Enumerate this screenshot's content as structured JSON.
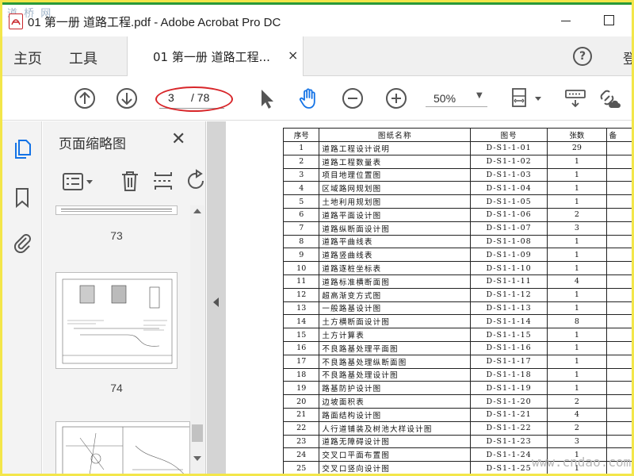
{
  "window": {
    "title": "01 第一册 道路工程.pdf - Adobe Acrobat Pro DC",
    "watermark": "道 桥 网"
  },
  "tabs": {
    "home_label": "主页",
    "tools_label": "工具",
    "document_tab_label": "01 第一册 道路工程...",
    "close_glyph": "×",
    "signin_label": "登"
  },
  "toolbar": {
    "current_page": "3",
    "total_pages": "/ 78",
    "zoom": "50%"
  },
  "thumbnail_pane": {
    "title": "页面缩略图",
    "close_glyph": "✕",
    "pages": [
      {
        "number": "73"
      },
      {
        "number": "74"
      },
      {
        "number": "75"
      }
    ]
  },
  "table": {
    "headers": [
      "序号",
      "图纸名称",
      "图号",
      "张数",
      "备"
    ],
    "rows": [
      [
        "1",
        "道路工程设计说明",
        "D-S1-1-01",
        "29"
      ],
      [
        "2",
        "道路工程数量表",
        "D-S1-1-02",
        "1"
      ],
      [
        "3",
        "项目地理位置图",
        "D-S1-1-03",
        "1"
      ],
      [
        "4",
        "区域路网规划图",
        "D-S1-1-04",
        "1"
      ],
      [
        "5",
        "土地利用规划图",
        "D-S1-1-05",
        "1"
      ],
      [
        "6",
        "道路平面设计图",
        "D-S1-1-06",
        "2"
      ],
      [
        "7",
        "道路纵断面设计图",
        "D-S1-1-07",
        "3"
      ],
      [
        "8",
        "道路平曲线表",
        "D-S1-1-08",
        "1"
      ],
      [
        "9",
        "道路竖曲线表",
        "D-S1-1-09",
        "1"
      ],
      [
        "10",
        "道路逐桩坐标表",
        "D-S1-1-10",
        "1"
      ],
      [
        "11",
        "道路标准横断面图",
        "D-S1-1-11",
        "4"
      ],
      [
        "12",
        "超高渐变方式图",
        "D-S1-1-12",
        "1"
      ],
      [
        "13",
        "一般路基设计图",
        "D-S1-1-13",
        "1"
      ],
      [
        "14",
        "土方横断面设计图",
        "D-S1-1-14",
        "8"
      ],
      [
        "15",
        "土方计算表",
        "D-S1-1-15",
        "1"
      ],
      [
        "16",
        "不良路基处理平面图",
        "D-S1-1-16",
        "1"
      ],
      [
        "17",
        "不良路基处理纵断面图",
        "D-S1-1-17",
        "1"
      ],
      [
        "18",
        "不良路基处理设计图",
        "D-S1-1-18",
        "1"
      ],
      [
        "19",
        "路基防护设计图",
        "D-S1-1-19",
        "1"
      ],
      [
        "20",
        "边坡面积表",
        "D-S1-1-20",
        "2"
      ],
      [
        "21",
        "路面结构设计图",
        "D-S1-1-21",
        "4"
      ],
      [
        "22",
        "人行道铺装及树池大样设计图",
        "D-S1-1-22",
        "2"
      ],
      [
        "23",
        "道路无障碍设计图",
        "D-S1-1-23",
        "3"
      ],
      [
        "24",
        "交叉口平面布置图",
        "D-S1-1-24",
        "1"
      ],
      [
        "25",
        "交叉口竖向设计图",
        "D-S1-1-25",
        "1"
      ]
    ]
  },
  "site_watermark": "www.cndao.com",
  "colors": {
    "frame_outer": "#f3e64a",
    "top_stripe": "#2a9a3a",
    "annotation_ellipse": "#d8262a",
    "accent_blue": "#1473e6"
  }
}
